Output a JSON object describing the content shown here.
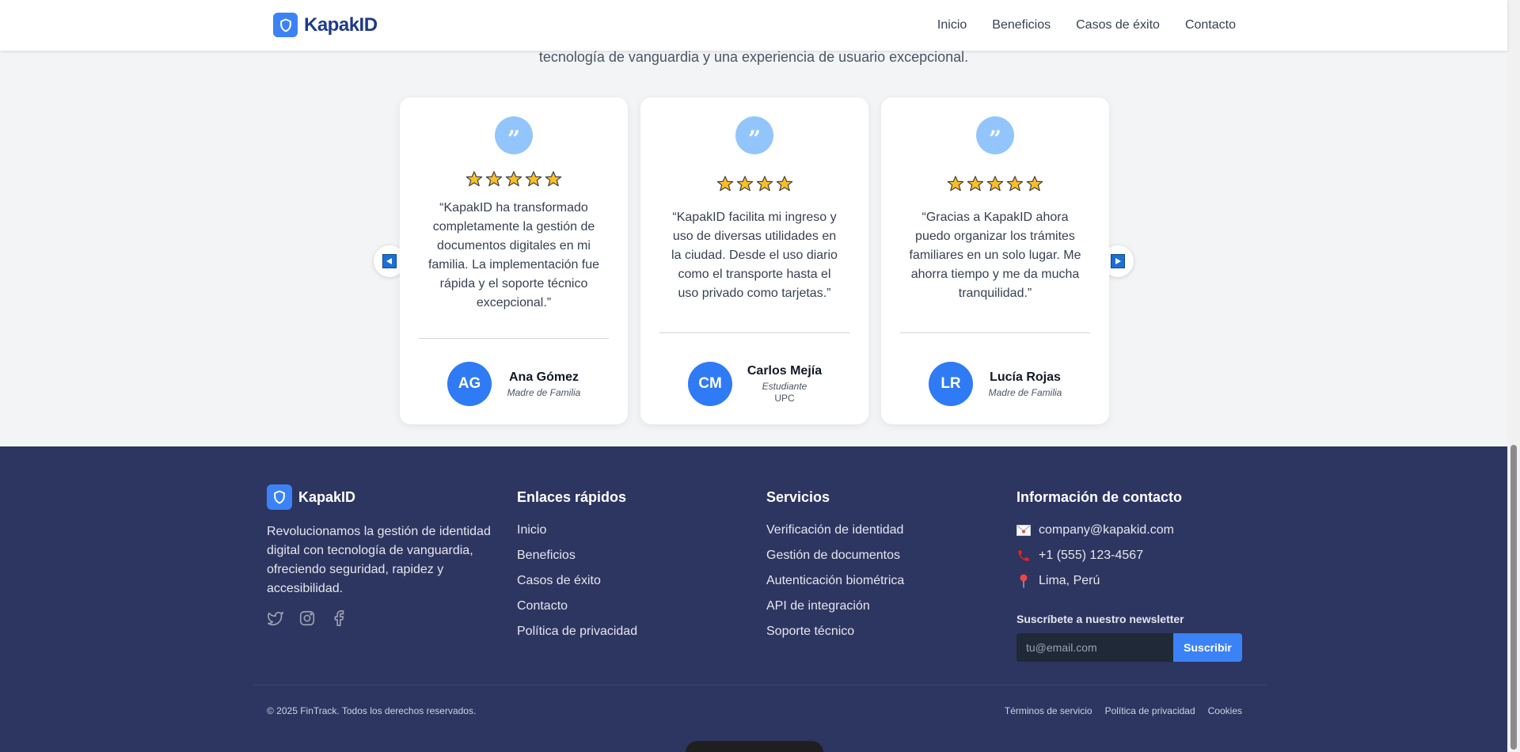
{
  "header": {
    "brand": "KapakID",
    "nav": [
      "Inicio",
      "Beneficios",
      "Casos de éxito",
      "Contacto"
    ]
  },
  "intro": {
    "text": "tecnología de vanguardia y una experiencia de usuario excepcional."
  },
  "testimonials": [
    {
      "rating": 5,
      "quote": "“KapakID ha transformado completamente la gestión de documentos digitales en mi familia. La implementación fue rápida y el soporte técnico excepcional.”",
      "initials": "AG",
      "name": "Ana Gómez",
      "role": "Madre de Familia",
      "org": ""
    },
    {
      "rating": 4,
      "quote": "“KapakID facilita mi ingreso y uso de diversas utilidades en la ciudad. Desde el uso diario como el transporte hasta el uso privado como tarjetas.”",
      "initials": "CM",
      "name": "Carlos Mejía",
      "role": "Estudiante",
      "org": "UPC"
    },
    {
      "rating": 5,
      "quote": "“Gracias a KapakID ahora puedo organizar los trámites familiares en un solo lugar. Me ahorra tiempo y me da mucha tranquilidad.”",
      "initials": "LR",
      "name": "Lucía Rojas",
      "role": "Madre de Familia",
      "org": ""
    }
  ],
  "icons": {
    "quote": "”",
    "prev": "arrow-left-icon",
    "next": "arrow-right-icon"
  },
  "footer": {
    "brand": "KapakID",
    "description": "Revolucionamos la gestión de identidad digital con tecnología de vanguardia, ofreciendo seguridad, rapidez y accesibilidad.",
    "social": [
      "twitter-icon",
      "instagram-icon",
      "facebook-icon"
    ],
    "quick_links": {
      "title": "Enlaces rápidos",
      "items": [
        "Inicio",
        "Beneficios",
        "Casos de éxito",
        "Contacto",
        "Política de privacidad"
      ]
    },
    "services": {
      "title": "Servicios",
      "items": [
        "Verificación de identidad",
        "Gestión de documentos",
        "Autenticación biométrica",
        "API de integración",
        "Soporte técnico"
      ]
    },
    "contact": {
      "title": "Información de contacto",
      "email": "company@kapakid.com",
      "phone": "+1 (555) 123-4567",
      "location": "Lima, Perú"
    },
    "newsletter": {
      "label": "Suscríbete a nuestro newsletter",
      "placeholder": "tu@email.com",
      "button": "Suscribir"
    },
    "copyright": "© 2025 FinTrack. Todos los derechos reservados.",
    "legal": [
      "Términos de servicio",
      "Política de privacidad",
      "Cookies"
    ]
  },
  "colors": {
    "brand": "#3b82f6",
    "brand_dark": "#1e3a8a",
    "footer_bg": "#2d3561",
    "avatar": "#2f7af5",
    "quote_circle": "#93c5fd",
    "star": "#fbbf24"
  }
}
